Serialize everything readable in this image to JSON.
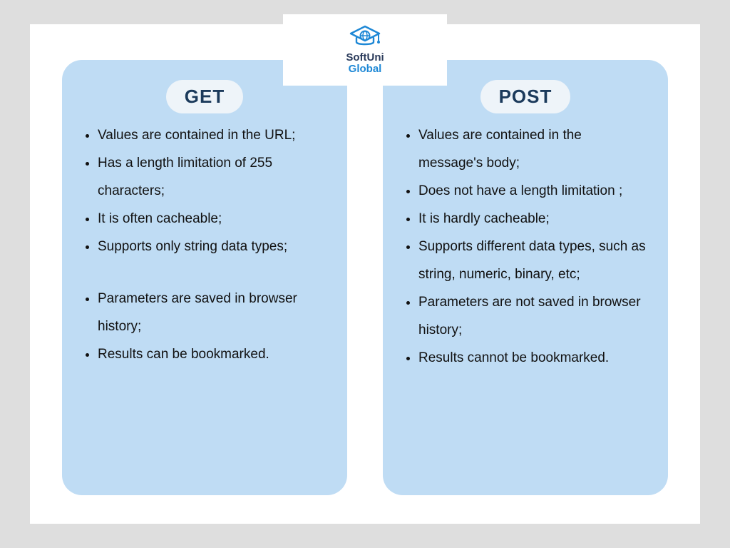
{
  "logo": {
    "line1": "SoftUni",
    "line2": "Global"
  },
  "cards": [
    {
      "badge": "GET",
      "group1": [
        "Values are contained in the URL;",
        "Has a length limitation of 255 characters;",
        "It is often cacheable;",
        "Supports only string data types;"
      ],
      "group2": [
        "Parameters are saved in browser history;",
        "Results can be bookmarked."
      ]
    },
    {
      "badge": "POST",
      "group1": [
        "Values are contained in the message's body;",
        "Does not have a length limitation ;",
        "It is hardly cacheable;",
        "Supports different data types, such as string, numeric, binary, etc;",
        "Parameters are not saved in browser history;",
        "Results cannot be bookmarked."
      ],
      "group2": []
    }
  ]
}
